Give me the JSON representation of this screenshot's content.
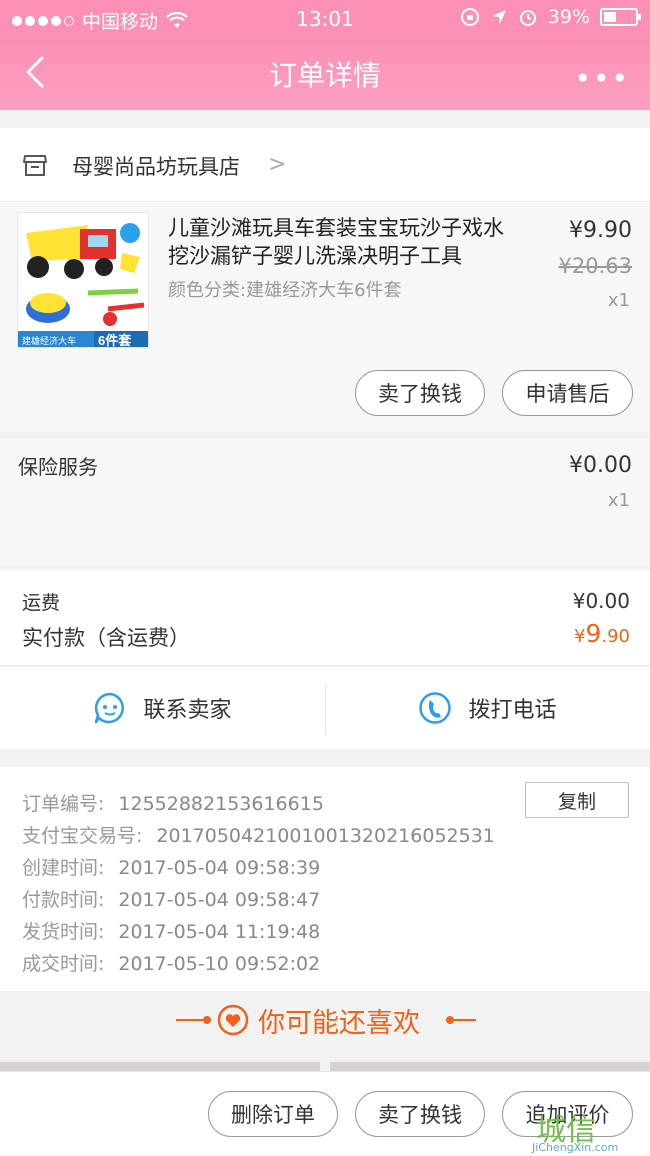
{
  "status_bar": {
    "carrier": "中国移动",
    "time": "13:01",
    "battery": "39%"
  },
  "nav": {
    "title": "订单详情",
    "more": "•••"
  },
  "shop": {
    "name": "母婴尚品坊玩具店"
  },
  "item": {
    "title": "儿童沙滩玩具车套装宝宝玩沙子戏水挖沙漏铲子婴儿洗澡决明子工具",
    "spec": "颜色分类:建雄经济大车6件套",
    "price": "¥9.90",
    "original_price": "¥20.63",
    "quantity": "x1",
    "thumb_caption": "建雄经济大车",
    "thumb_badge": "6件套",
    "actions": [
      "卖了换钱",
      "申请售后"
    ]
  },
  "insurance": {
    "label": "保险服务",
    "price": "¥0.00",
    "quantity": "x1"
  },
  "summary": {
    "shipping_label": "运费",
    "shipping_value": "¥0.00",
    "paid_label": "实付款（含运费）",
    "paid_currency": "¥",
    "paid_int": "9",
    "paid_dec": ".90"
  },
  "contact": {
    "seller": "联系卖家",
    "phone": "拨打电话"
  },
  "order_info": {
    "copy": "复制",
    "rows": [
      {
        "label": "订单编号:",
        "value": "12552882153616615"
      },
      {
        "label": "支付宝交易号:",
        "value": "2017050421001001320216052531"
      },
      {
        "label": "创建时间:",
        "value": "2017-05-04 09:58:39"
      },
      {
        "label": "付款时间:",
        "value": "2017-05-04 09:58:47"
      },
      {
        "label": "发货时间:",
        "value": "2017-05-04 11:19:48"
      },
      {
        "label": "成交时间:",
        "value": "2017-05-10 09:52:02"
      }
    ]
  },
  "recommend": {
    "title": "你可能还喜欢"
  },
  "bottom_bar": {
    "buttons": [
      "删除订单",
      "卖了换钱",
      "追加评价"
    ]
  },
  "watermark": {
    "logo": "城信",
    "url": "JiChengXin.com"
  },
  "colors": {
    "brand_pink": "#fb8fb6",
    "accent_orange": "#f06218",
    "icon_blue": "#2e9fe6"
  }
}
